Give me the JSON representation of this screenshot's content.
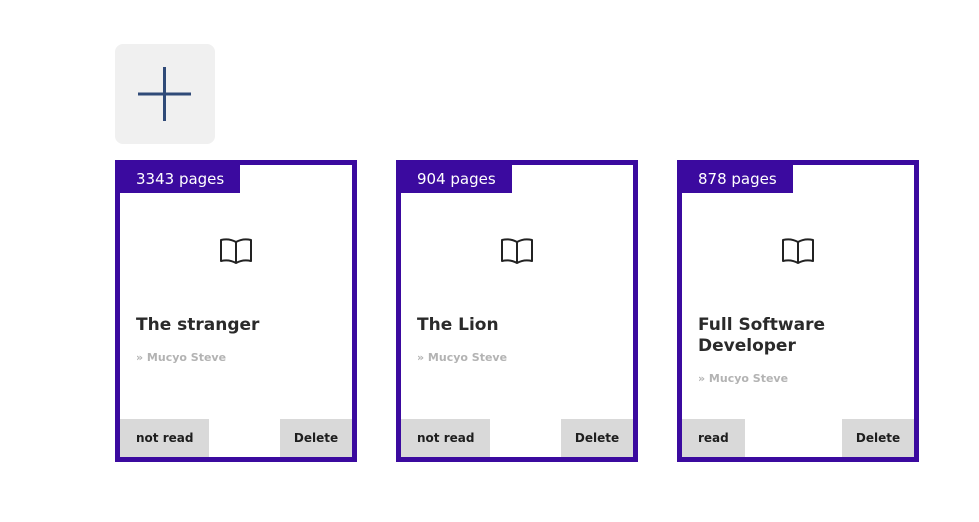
{
  "add_button": {
    "icon": "plus-icon"
  },
  "books": [
    {
      "pages": "3343 pages",
      "icon": "open-book-icon",
      "title": "The stranger",
      "author": "» Mucyo Steve",
      "read_status": "not read",
      "delete_label": "Delete"
    },
    {
      "pages": "904 pages",
      "icon": "open-book-icon",
      "title": "The Lion",
      "author": "» Mucyo Steve",
      "read_status": "not read",
      "delete_label": "Delete"
    },
    {
      "pages": "878 pages",
      "icon": "open-book-icon",
      "title": "Full Software Developer",
      "author": "» Mucyo Steve",
      "read_status": "read",
      "delete_label": "Delete"
    }
  ],
  "colors": {
    "card_border": "#3b0a9f",
    "badge_bg": "#3b0a9f",
    "button_bg": "#d9d9d9",
    "add_bg": "#f0f0f0",
    "plus": "#2f4a78"
  }
}
